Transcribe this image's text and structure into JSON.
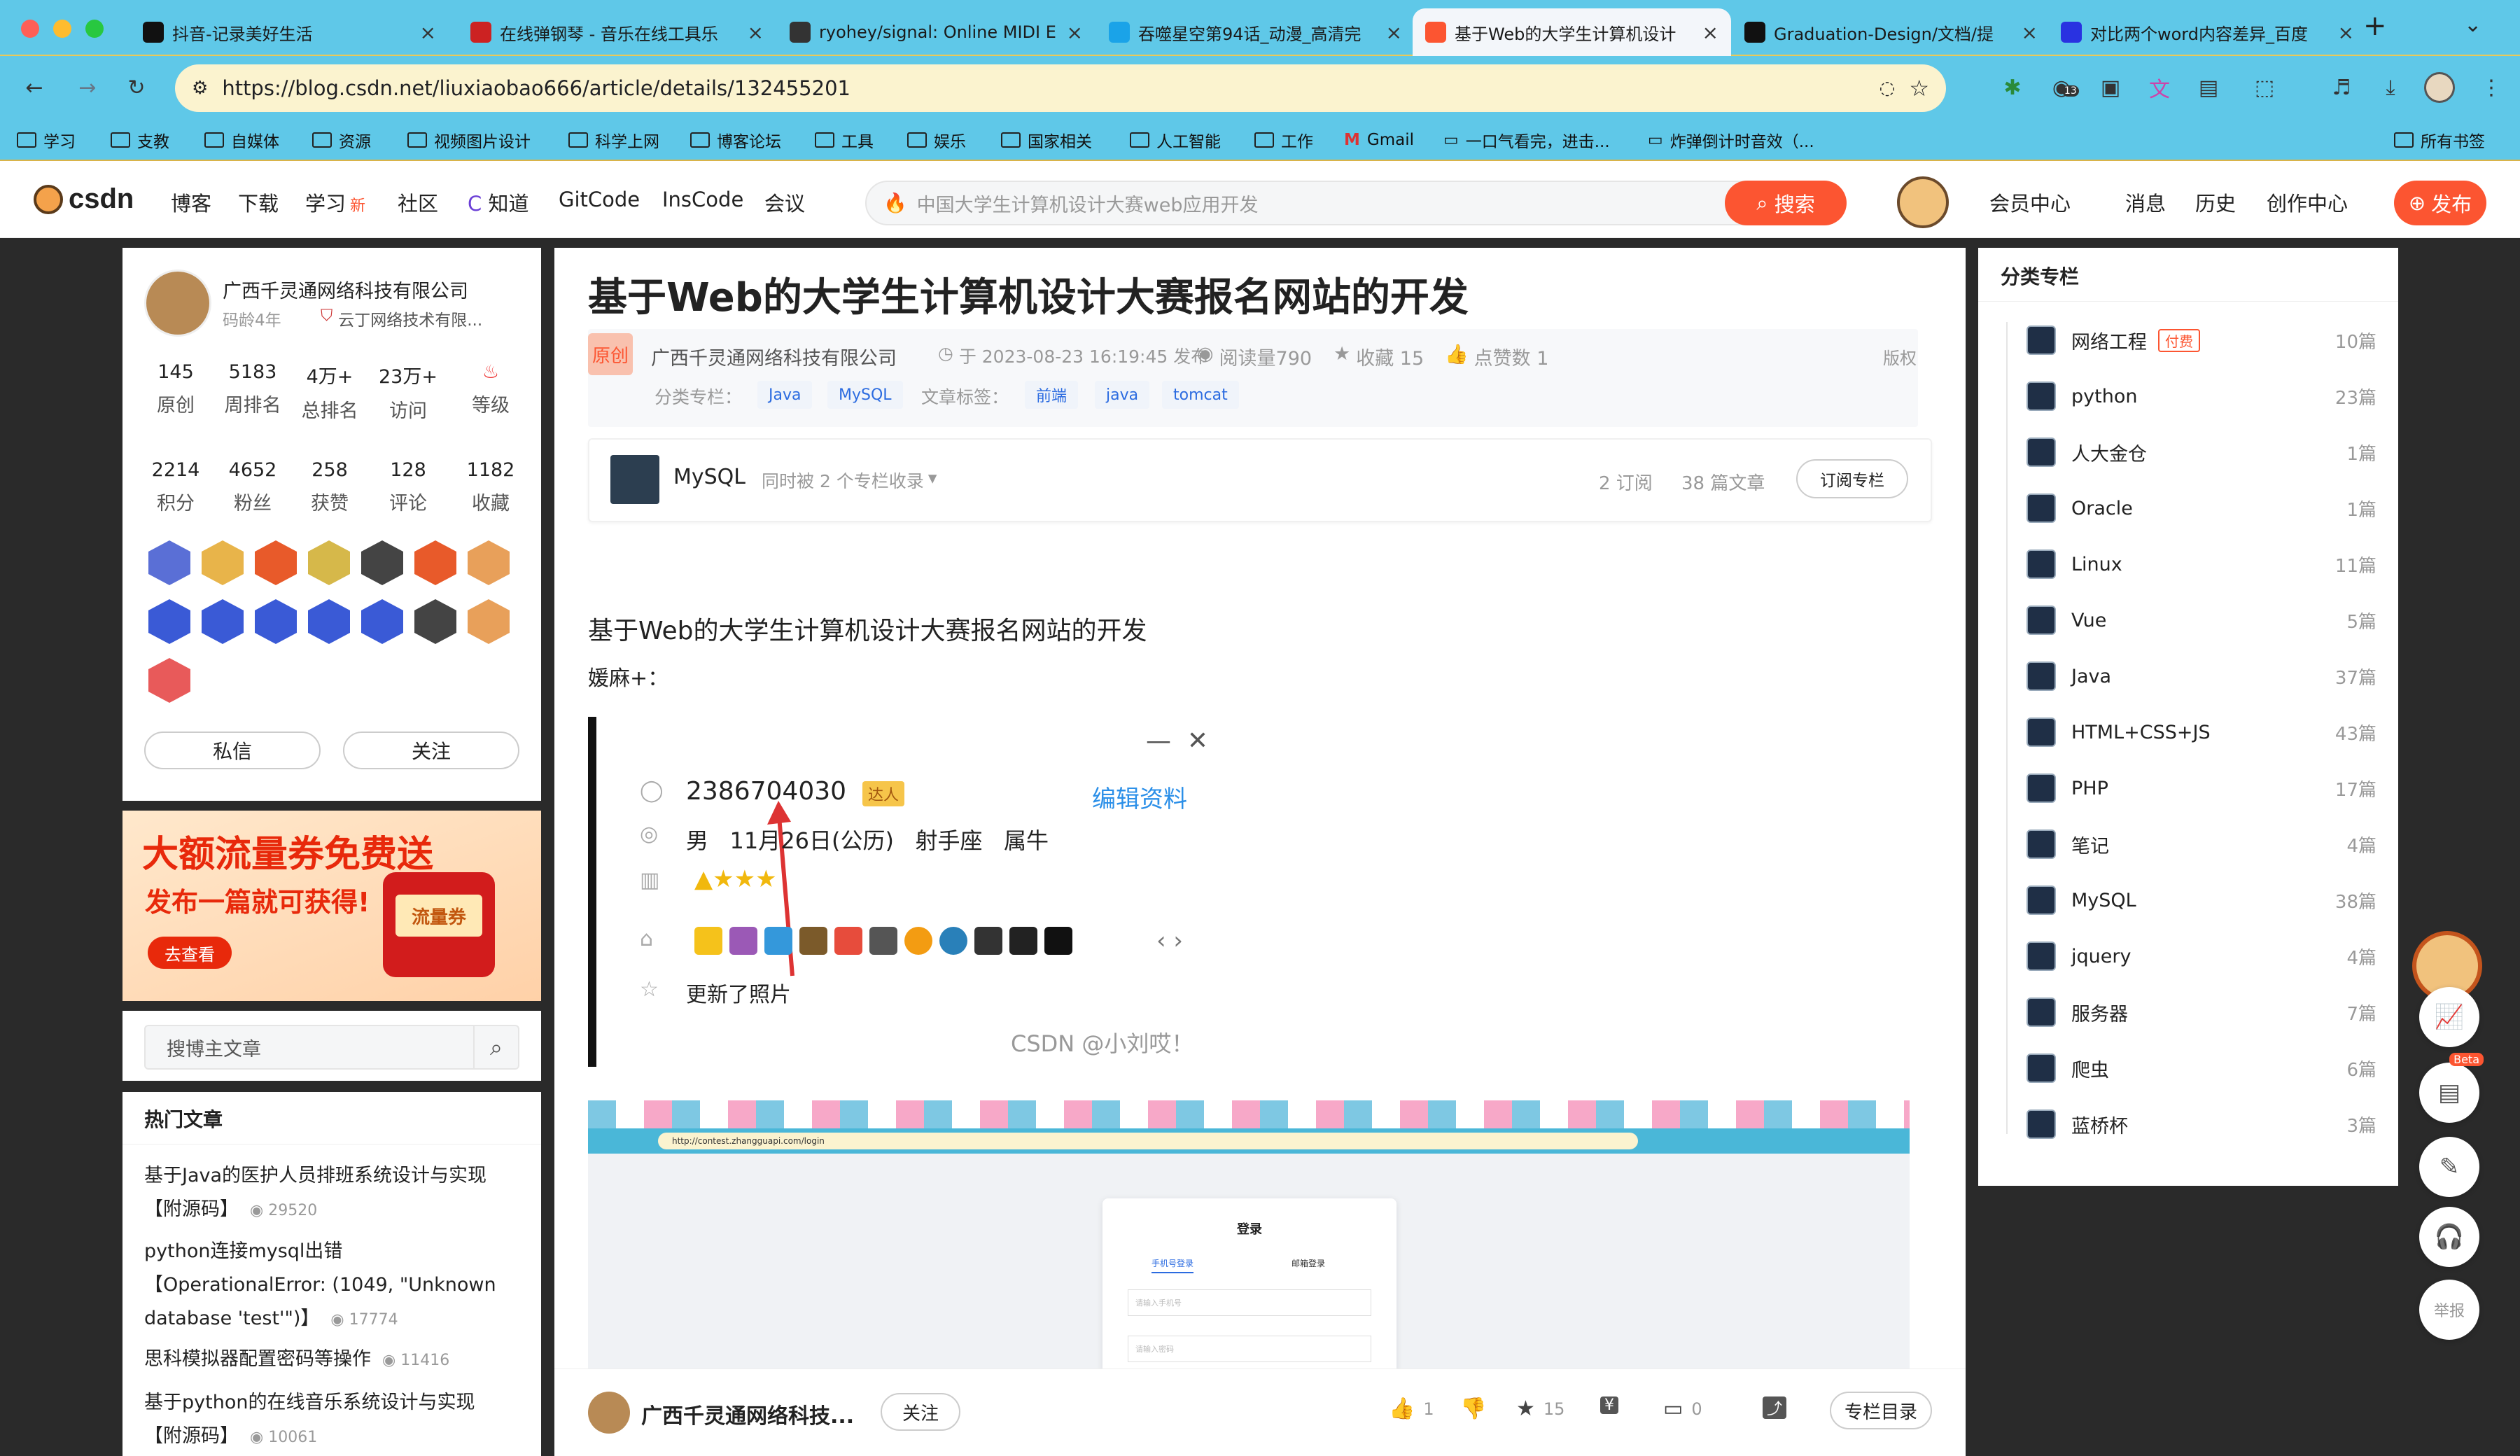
{
  "browser": {
    "tabs": [
      {
        "title": "抖音-记录美好生活",
        "color": "#111"
      },
      {
        "title": "在线弹钢琴 - 音乐在线工具乐",
        "color": "#c22"
      },
      {
        "title": "ryohey/signal: Online MIDI E",
        "color": "#333"
      },
      {
        "title": "吞噬星空第94话_动漫_高清完",
        "color": "#1aa3e8"
      },
      {
        "title": "基于Web的大学生计算机设计",
        "color": "#fc5531"
      },
      {
        "title": "Graduation-Design/文档/提",
        "color": "#111"
      },
      {
        "title": "对比两个word内容差异_百度",
        "color": "#2932e1"
      }
    ],
    "url": "https://blog.csdn.net/liuxiaobao666/article/details/132455201",
    "ext_badge": "13",
    "bookmarks": [
      "学习",
      "支教",
      "自媒体",
      "资源",
      "视频图片设计",
      "科学上网",
      "博客论坛",
      "工具",
      "娱乐",
      "国家相关",
      "人工智能",
      "工作",
      "Gmail",
      "一口气看完，进击...",
      "炸弹倒计时音效（..."
    ],
    "all_bookmarks": "所有书签"
  },
  "csdn": {
    "logo": "csdn",
    "nav": [
      "博客",
      "下载",
      "学习",
      "社区",
      "知道",
      "GitCode",
      "InsCode",
      "会议"
    ],
    "nav_new": "新",
    "search_placeholder": "中国大学生计算机设计大赛web应用开发",
    "search_btn": "搜索",
    "right_nav": [
      "会员中心",
      "消息",
      "历史",
      "创作中心"
    ],
    "publish": "发布"
  },
  "profile": {
    "name": "广西千灵通网络科技有限公司",
    "years": "码龄4年",
    "org": "云丁网络技术有限...",
    "stats1": [
      {
        "v": "145",
        "l": "原创"
      },
      {
        "v": "5183",
        "l": "周排名"
      },
      {
        "v": "4万+",
        "l": "总排名"
      },
      {
        "v": "23万+",
        "l": "访问"
      },
      {
        "v": "",
        "l": "等级"
      }
    ],
    "stats2": [
      {
        "v": "2214",
        "l": "积分"
      },
      {
        "v": "4652",
        "l": "粉丝"
      },
      {
        "v": "258",
        "l": "获赞"
      },
      {
        "v": "128",
        "l": "评论"
      },
      {
        "v": "1182",
        "l": "收藏"
      }
    ],
    "msg_btn": "私信",
    "follow_btn": "关注"
  },
  "ad": {
    "title": "大额流量券免费送",
    "sub": "发布一篇就可获得!",
    "cta": "去查看",
    "coupon": "流量券"
  },
  "side_search": {
    "placeholder": "搜博主文章"
  },
  "hot": {
    "title": "热门文章",
    "items": [
      {
        "t": "基于Java的医护人员排班系统设计与实现【附源码】",
        "c": "29520"
      },
      {
        "t": "python连接mysql出错【OperationalError: (1049, \"Unknown database 'test'\")】",
        "c": "17774"
      },
      {
        "t": "思科模拟器配置密码等操作",
        "c": "11416"
      },
      {
        "t": "基于python的在线音乐系统设计与实现【附源码】",
        "c": "10061"
      }
    ]
  },
  "article": {
    "title": "基于Web的大学生计算机设计大赛报名网站的开发",
    "original": "原创",
    "author": "广西千灵通网络科技有限公司",
    "date": "于 2023-08-23 16:19:45 发布",
    "reads": "阅读量790",
    "fav": "收藏 15",
    "likes": "点赞数 1",
    "copyright": "版权",
    "cat_label": "分类专栏：",
    "cats": [
      "Java",
      "MySQL"
    ],
    "tag_label": "文章标签：",
    "tags": [
      "前端",
      "java",
      "tomcat"
    ],
    "column": {
      "name": "MySQL",
      "also": "同时被 2 个专栏收录",
      "subs": "2 订阅",
      "count": "38 篇文章",
      "btn": "订阅专栏"
    },
    "h2": "基于Web的大学生计算机设计大赛报名网站的开发",
    "p1": "媛麻+：",
    "qq": {
      "num": "2386704030",
      "tag": "达人",
      "edit": "编辑资料",
      "info": "男   11月26日(公历)   射手座   属牛",
      "photo": "更新了照片",
      "wm": "CSDN @小刘哎！"
    },
    "shot2": {
      "url": "http://contest.zhangguapi.com/login",
      "login": "登录",
      "tab1": "手机号登录",
      "tab2": "邮箱登录",
      "ph1": "请输入手机号",
      "ph2": "请输入密码"
    }
  },
  "bottom": {
    "author": "广西千灵通网络科技...",
    "follow": "关注",
    "like": "1",
    "fav": "15",
    "comment": "0",
    "toc": "专栏目录"
  },
  "categories": {
    "title": "分类专栏",
    "paid": "付费",
    "items": [
      {
        "n": "网络工程",
        "c": "10篇"
      },
      {
        "n": "python",
        "c": "23篇"
      },
      {
        "n": "人大金仓",
        "c": "1篇"
      },
      {
        "n": "Oracle",
        "c": "1篇"
      },
      {
        "n": "Linux",
        "c": "11篇"
      },
      {
        "n": "Vue",
        "c": "5篇"
      },
      {
        "n": "Java",
        "c": "37篇"
      },
      {
        "n": "HTML+CSS+JS",
        "c": "43篇"
      },
      {
        "n": "PHP",
        "c": "17篇"
      },
      {
        "n": "笔记",
        "c": "4篇"
      },
      {
        "n": "MySQL",
        "c": "38篇"
      },
      {
        "n": "jquery",
        "c": "4篇"
      },
      {
        "n": "服务器",
        "c": "7篇"
      },
      {
        "n": "爬虫",
        "c": "6篇"
      },
      {
        "n": "蓝桥杯",
        "c": "3篇"
      }
    ]
  },
  "float": {
    "beta": "Beta",
    "report": "举报"
  }
}
